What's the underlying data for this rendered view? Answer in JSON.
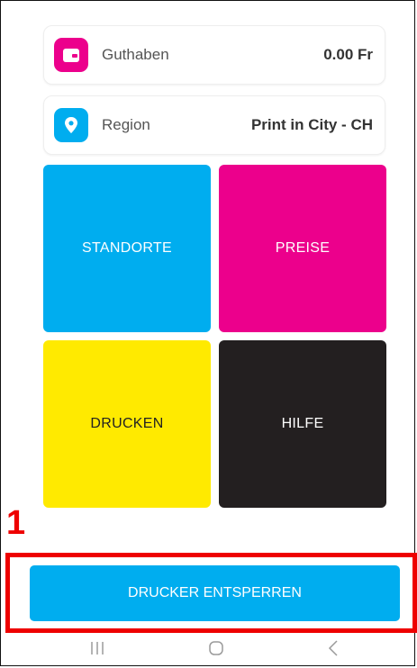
{
  "balance": {
    "label": "Guthaben",
    "value": "0.00 Fr",
    "icon": "wallet-icon",
    "color": "#ec008c"
  },
  "region": {
    "label": "Region",
    "value": "Print in City - CH",
    "icon": "location-pin-icon",
    "color": "#00adef"
  },
  "tiles": [
    {
      "label": "STANDORTE",
      "color": "#00adef",
      "text_color": "#ffffff"
    },
    {
      "label": "PREISE",
      "color": "#ec008c",
      "text_color": "#ffffff"
    },
    {
      "label": "DRUCKEN",
      "color": "#ffea00",
      "text_color": "#222222"
    },
    {
      "label": "HILFE",
      "color": "#231f20",
      "text_color": "#ffffff"
    }
  ],
  "annotation": {
    "step": "1",
    "color": "#ee0000"
  },
  "primary_action": {
    "label": "DRUCKER ENTSPERREN",
    "color": "#00adef"
  },
  "nav": {
    "icons": [
      "recent-apps-icon",
      "home-icon",
      "back-icon"
    ]
  }
}
